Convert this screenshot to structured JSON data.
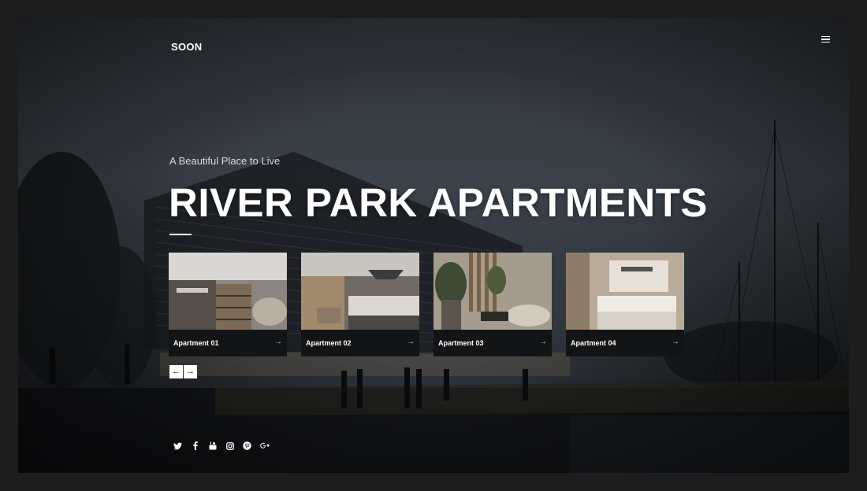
{
  "brand": {
    "name": "SOON"
  },
  "hero": {
    "tagline": "A Beautiful Place to Live",
    "title": "RIVER PARK APARTMENTS"
  },
  "apartments": [
    {
      "label": "Apartment 01",
      "arrow": "→",
      "thumb": "kitchen-living-photo"
    },
    {
      "label": "Apartment 02",
      "arrow": "→",
      "thumb": "kitchen-island-photo"
    },
    {
      "label": "Apartment 03",
      "arrow": "→",
      "thumb": "living-room-plants-photo"
    },
    {
      "label": "Apartment 04",
      "arrow": "→",
      "thumb": "bathroom-vanity-photo"
    }
  ],
  "slider": {
    "prev": "←",
    "next": "→"
  },
  "social": [
    "twitter-icon",
    "facebook-icon",
    "youtube-icon",
    "instagram-icon",
    "pinterest-icon",
    "google-plus-icon"
  ],
  "menu": {
    "icon": "hamburger-menu-icon"
  },
  "colors": {
    "background": "#1d1d1d",
    "overlay": "#2e3238",
    "text": "#ffffff",
    "caption": "#121316"
  }
}
